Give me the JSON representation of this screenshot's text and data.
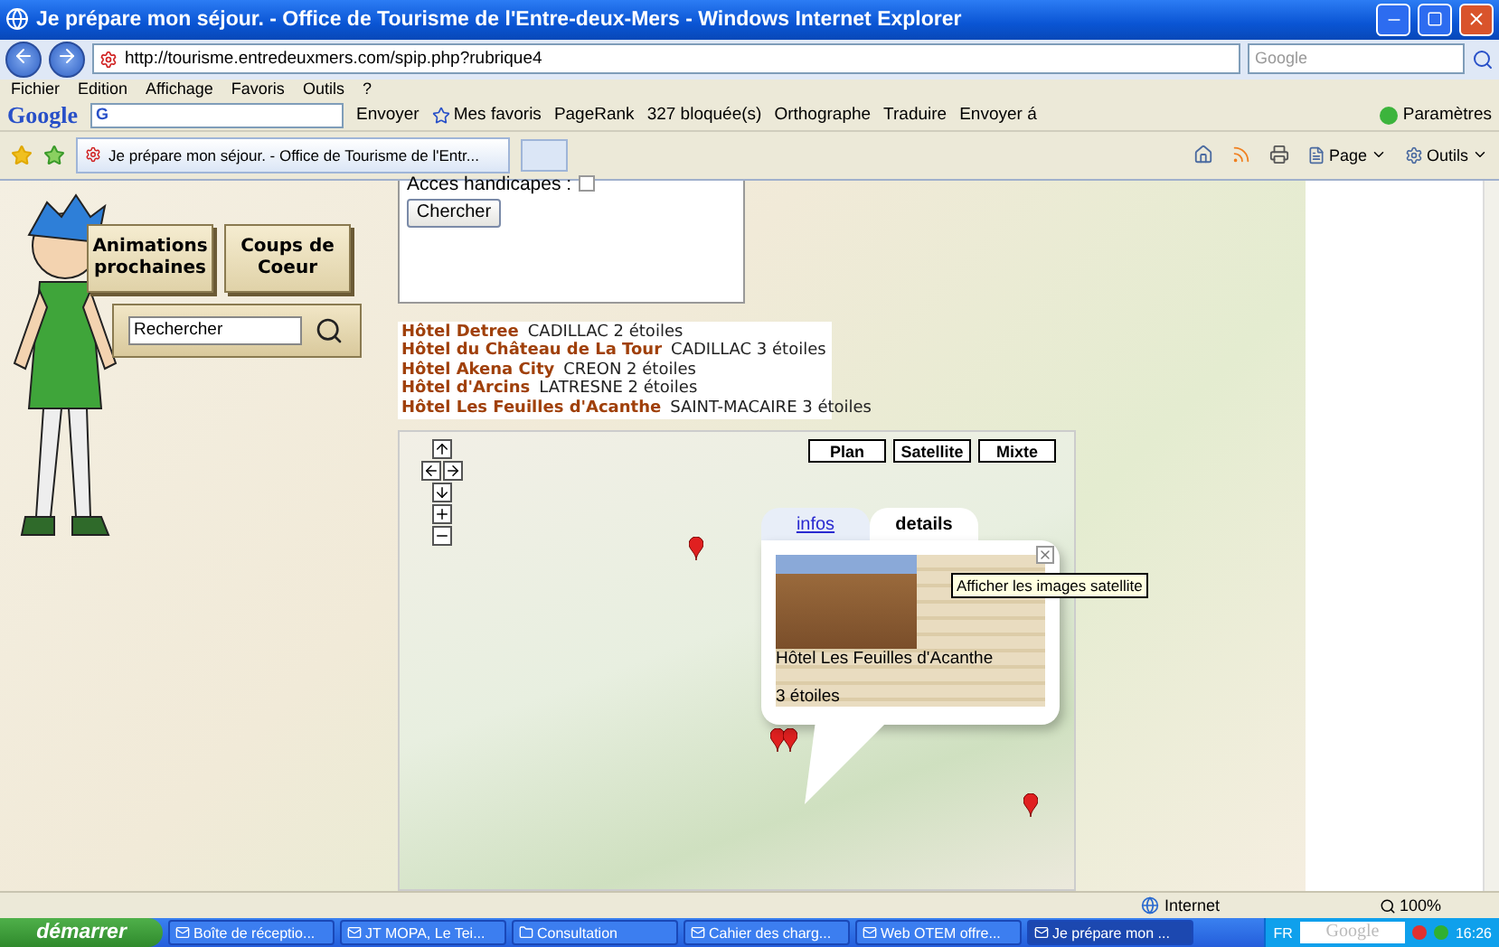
{
  "window": {
    "title": "Je prépare mon séjour. - Office de Tourisme de l'Entre-deux-Mers - Windows Internet Explorer"
  },
  "address_bar": {
    "url": "http://tourisme.entredeuxmers.com/spip.php?rubrique4",
    "search_placeholder": "Google"
  },
  "menu": [
    "Fichier",
    "Edition",
    "Affichage",
    "Favoris",
    "Outils",
    "?"
  ],
  "google_toolbar": {
    "logo": "Google",
    "logo_letter": "G",
    "items": [
      "Envoyer",
      "Mes favoris",
      "PageRank",
      "327 bloquée(s)",
      "Orthographe",
      "Traduire",
      "Envoyer á"
    ],
    "settings": "Paramètres"
  },
  "tab": {
    "title": "Je prépare mon séjour. - Office de Tourisme de l'Entr..."
  },
  "command_bar": [
    "Page",
    "Outils"
  ],
  "sidebar": {
    "buttons": [
      "Animations prochaines",
      "Coups de Coeur"
    ],
    "search_value": "Rechercher"
  },
  "form": {
    "checkbox_label": "Acces handicapes :",
    "checked": false,
    "button": "Chercher"
  },
  "hotels": [
    {
      "name": "Hôtel Detree",
      "details": "CADILLAC 2 étoiles"
    },
    {
      "name": "Hôtel du Château de La Tour",
      "details": "CADILLAC 3 étoiles"
    },
    {
      "name": "Hôtel Akena City",
      "details": "CREON 2 étoiles"
    },
    {
      "name": "Hôtel d'Arcins",
      "details": "LATRESNE 2 étoiles"
    },
    {
      "name": "Hôtel Les Feuilles d'Acanthe",
      "details": "SAINT-MACAIRE 3 étoiles"
    }
  ],
  "map": {
    "types": [
      "Plan",
      "Satellite",
      "Mixte"
    ],
    "info_tabs": [
      {
        "label": "infos",
        "selected": false
      },
      {
        "label": "details",
        "selected": true
      }
    ],
    "info_title": "Hôtel Les Feuilles d'Acanthe",
    "info_rating": "3 étoiles",
    "tooltip": "Afficher les images satellite"
  },
  "status_bar": {
    "zone": "Internet",
    "zoom": "100%"
  },
  "taskbar": {
    "start": "démarrer",
    "tasks": [
      {
        "label": "Boîte de réceptio...",
        "selected": false
      },
      {
        "label": "JT MOPA, Le Tei...",
        "selected": false
      },
      {
        "label": "Consultation",
        "selected": false
      },
      {
        "label": "Cahier des charg...",
        "selected": false
      },
      {
        "label": "Web OTEM offre...",
        "selected": false
      },
      {
        "label": "Je prépare mon ...",
        "selected": true
      }
    ],
    "lang": "FR",
    "search_logo": "Google",
    "time": "16:26"
  }
}
